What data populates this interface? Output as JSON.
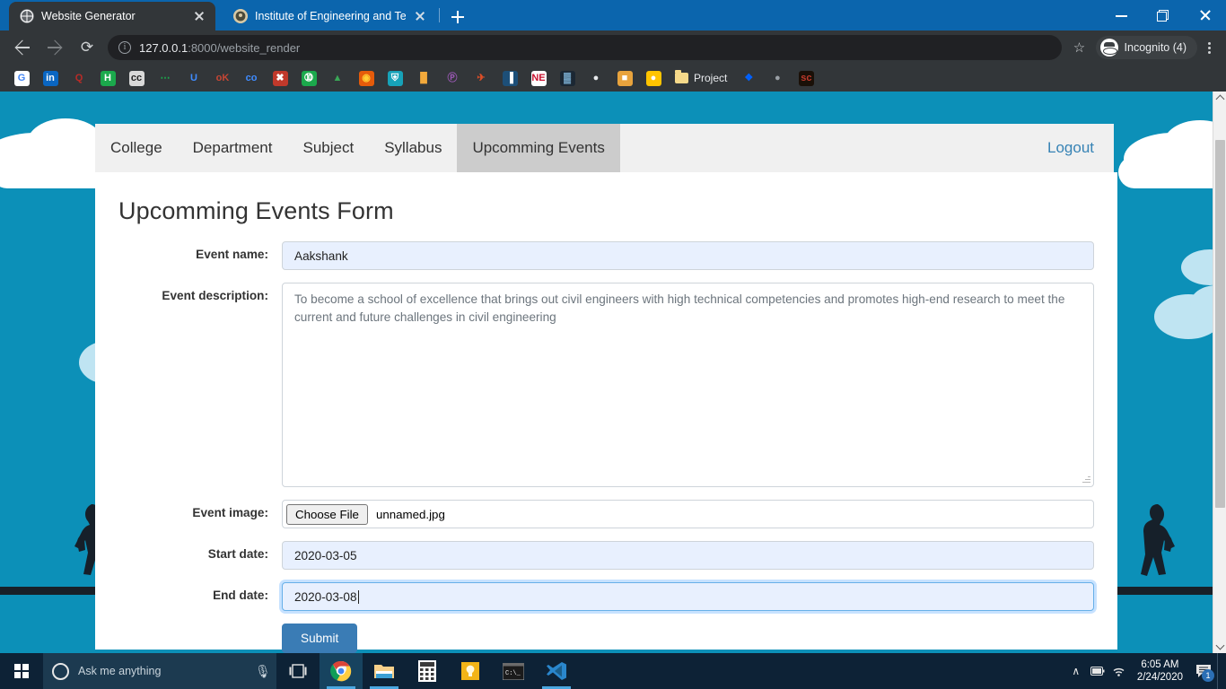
{
  "browser": {
    "tabs": [
      {
        "title": "Website Generator",
        "favicon_name": "globe-favicon",
        "favicon_color": "#3c4043",
        "active": true
      },
      {
        "title": "Institute of Engineering and Tech",
        "favicon_name": "institute-favicon",
        "favicon_color": "#8a7a5c",
        "active": false
      }
    ],
    "new_tab_label": "+",
    "window_controls": {
      "minimize": "—",
      "maximize": "❐",
      "close": "✕"
    },
    "omnibox": {
      "host": "127.0.0.1",
      "rest": ":8000/website_render",
      "full_url": "127.0.0.1:8000/website_render",
      "info_icon": "ℹ",
      "star_icon": "☆"
    },
    "profile": {
      "label": "Incognito (4)",
      "icon_name": "incognito-icon"
    },
    "menu_icon": "kebab-menu-icon",
    "bookmarks": [
      {
        "name": "google",
        "glyph": "G",
        "bg": "#ffffff",
        "fg": "#4285f4"
      },
      {
        "name": "linkedin",
        "glyph": "in",
        "bg": "#0a66c2",
        "fg": "#ffffff"
      },
      {
        "name": "quora",
        "glyph": "Q",
        "bg": "#323639",
        "fg": "#b92b27"
      },
      {
        "name": "hackerrank",
        "glyph": "H",
        "bg": "#1ba94c",
        "fg": "#ffffff"
      },
      {
        "name": "creative-commons",
        "glyph": "cc",
        "bg": "#d9d9d9",
        "fg": "#222222"
      },
      {
        "name": "hr-dotted",
        "glyph": "⋯",
        "bg": "#323639",
        "fg": "#1ba94c"
      },
      {
        "name": "unacademy",
        "glyph": "U",
        "bg": "#323639",
        "fg": "#3f8cff"
      },
      {
        "name": "oracle",
        "glyph": "oK",
        "bg": "#323639",
        "fg": "#c74634"
      },
      {
        "name": "codeforces",
        "glyph": "co",
        "bg": "#323639",
        "fg": "#3f8cff"
      },
      {
        "name": "red-app",
        "glyph": "✖",
        "bg": "#c0392b",
        "fg": "#ffffff"
      },
      {
        "name": "whatsapp",
        "glyph": "➉",
        "bg": "#1ba94c",
        "fg": "#ffffff"
      },
      {
        "name": "google-drive",
        "glyph": "▲",
        "bg": "#323639",
        "fg": "#3aa757"
      },
      {
        "name": "firefox",
        "glyph": "◉",
        "bg": "#e55b0a",
        "fg": "#ffcc33"
      },
      {
        "name": "shield",
        "glyph": "⛨",
        "bg": "#17a2b8",
        "fg": "#ffffff"
      },
      {
        "name": "analytics",
        "glyph": "█",
        "bg": "#323639",
        "fg": "#f2a93b"
      },
      {
        "name": "purple-app",
        "glyph": "Ⓟ",
        "bg": "#323639",
        "fg": "#9b59b6"
      },
      {
        "name": "adobe",
        "glyph": "✈",
        "bg": "#323639",
        "fg": "#e34f26"
      },
      {
        "name": "blue-doc",
        "glyph": "▐",
        "bg": "#1d4f78",
        "fg": "#ffffff"
      },
      {
        "name": "ne-news",
        "glyph": "NE",
        "bg": "#ffffff",
        "fg": "#c8102e"
      },
      {
        "name": "dark-doc",
        "glyph": "▓",
        "bg": "#1b2733",
        "fg": "#7fb4d8"
      },
      {
        "name": "github",
        "glyph": "●",
        "bg": "#323639",
        "fg": "#e8eaed"
      },
      {
        "name": "quiz-orange",
        "glyph": "■",
        "bg": "#e8a33d",
        "fg": "#ffffff"
      },
      {
        "name": "coursera",
        "glyph": "●",
        "bg": "#ffc400",
        "fg": "#ffffff"
      },
      {
        "name": "project-folder",
        "glyph": "",
        "bg": "#f5d98a",
        "fg": "#ffffff",
        "label": "Project"
      },
      {
        "name": "dropbox",
        "glyph": "❖",
        "bg": "#323639",
        "fg": "#0061ff"
      },
      {
        "name": "grey-bulb",
        "glyph": "●",
        "bg": "#323639",
        "fg": "#9aa0a6"
      },
      {
        "name": "sc-app",
        "glyph": "sc",
        "bg": "#1a1008",
        "fg": "#c0392b"
      }
    ],
    "bookmark_folder_label": "Project"
  },
  "site": {
    "nav": {
      "items": [
        {
          "label": "College",
          "active": false
        },
        {
          "label": "Department",
          "active": false
        },
        {
          "label": "Subject",
          "active": false
        },
        {
          "label": "Syllabus",
          "active": false
        },
        {
          "label": "Upcomming Events",
          "active": true
        }
      ],
      "logout_label": "Logout"
    },
    "form": {
      "title": "Upcomming Events Form",
      "fields": {
        "event_name": {
          "label": "Event name:",
          "value": "Aakshank"
        },
        "event_description": {
          "label": "Event description:",
          "value": "To become a school of excellence that brings out civil engineers with high technical competencies and promotes high-end research to meet the current and future challenges in civil engineering"
        },
        "event_image": {
          "label": "Event image:",
          "button_label": "Choose File",
          "filename": "unnamed.jpg"
        },
        "start_date": {
          "label": "Start date:",
          "value": "2020-03-05"
        },
        "end_date": {
          "label": "End date:",
          "value": "2020-03-08"
        }
      },
      "submit_label": "Submit"
    },
    "colors": {
      "accent_teal": "#0c90b8",
      "active_tab_bg": "#cccccc",
      "submit_blue": "#3a7cb5",
      "link_blue": "#3783b5"
    }
  },
  "scrollbar": {
    "up_arrow": "▲",
    "down_arrow": "▼"
  },
  "taskbar": {
    "start_label": "start-button",
    "search_placeholder": "Ask me anything",
    "items": [
      {
        "name": "task-view",
        "glyph": "❑"
      },
      {
        "name": "chrome",
        "glyph": "◉",
        "active": true
      },
      {
        "name": "file-explorer",
        "glyph": "▤"
      },
      {
        "name": "calculator",
        "glyph": "⌸"
      },
      {
        "name": "sticky-notes",
        "glyph": "■"
      },
      {
        "name": "command-prompt",
        "glyph": "▣"
      },
      {
        "name": "vs-code",
        "glyph": "⬒"
      }
    ],
    "tray": {
      "chevron": "∧",
      "battery": "▭",
      "network": "◠"
    },
    "clock": {
      "time": "6:05 AM",
      "date": "2/24/2020"
    },
    "notification_count": "1"
  }
}
